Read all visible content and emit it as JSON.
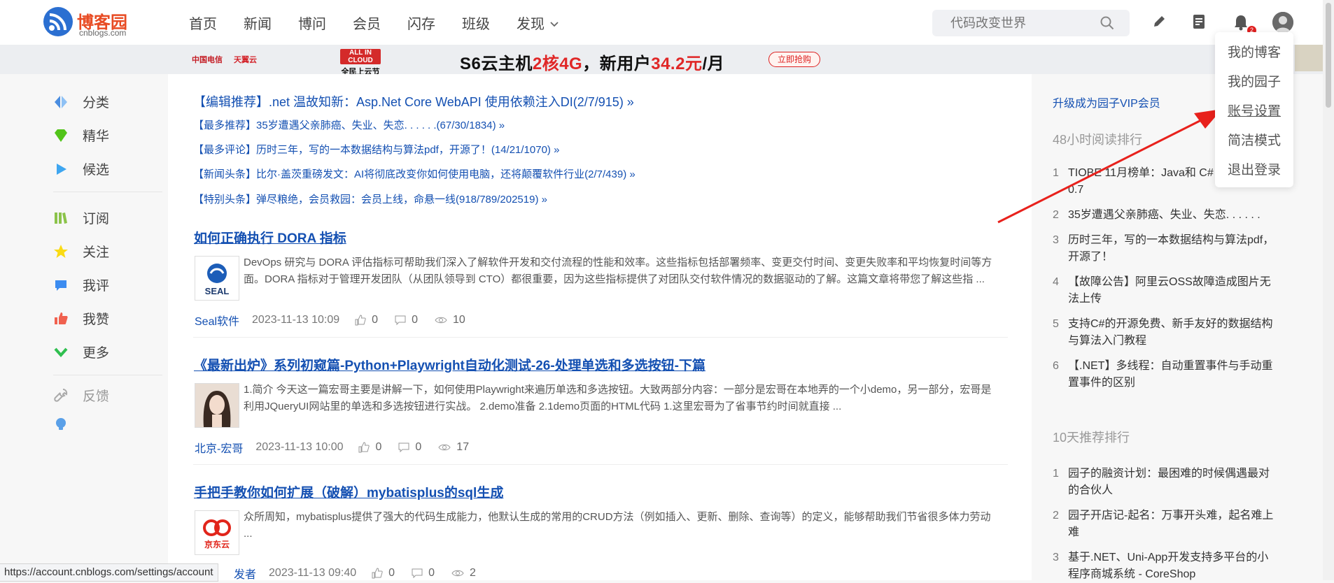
{
  "brand": {
    "name": "博客园",
    "domain": "cnblogs.com"
  },
  "nav": {
    "items": [
      "首页",
      "新闻",
      "博问",
      "会员",
      "闪存",
      "班级",
      "发现"
    ],
    "search_placeholder": "代码改变世界",
    "notification_count": "2"
  },
  "banner": {
    "brand1": "中国电信",
    "brand2": "天翼云",
    "tag_top": "ALL IN CLOUD",
    "tag_bottom": "全民上云节",
    "main_a": "S6云主机",
    "main_b": "2核4G",
    "main_c": "，新用户",
    "main_d": "34.2元",
    "main_e": "/月",
    "cta": "立即抢购"
  },
  "left": {
    "items": [
      "分类",
      "精华",
      "候选",
      "订阅",
      "关注",
      "我评",
      "我赞",
      "更多",
      "反馈"
    ]
  },
  "recommend": [
    "【编辑推荐】.net 温故知新：Asp.Net Core WebAPI 使用依赖注入DI(2/7/915) »",
    "【最多推荐】35岁遭遇父亲肺癌、失业、失恋. . . . . .(67/30/1834) »",
    "【最多评论】历时三年，写的一本数据结构与算法pdf，开源了！(14/21/1070) »",
    "【新闻头条】比尔·盖茨重磅发文：AI将彻底改变你如何使用电脑，还将颠覆软件行业(2/7/439) »",
    "【特别头条】弹尽粮绝，会员救园：会员上线，命悬一线(918/789/202519) »"
  ],
  "posts": [
    {
      "title": "如何正确执行 DORA 指标",
      "summary": "DevOps 研究与 DORA 评估指标可帮助我们深入了解软件开发和交付流程的性能和效率。这些指标包括部署频率、变更交付时间、变更失败率和平均恢复时间等方面。DORA 指标对于管理开发团队（从团队领导到 CTO）都很重要，因为这些指标提供了对团队交付软件情况的数据驱动的了解。这篇文章将带您了解这些指 ...",
      "author": "Seal软件",
      "date": "2023-11-13 10:09",
      "likes": "0",
      "comments": "0",
      "views": "10",
      "thumb_label": "SEAL"
    },
    {
      "title": "《最新出炉》系列初窥篇-Python+Playwright自动化测试-26-处理单选和多选按钮-下篇",
      "summary": "1.简介 今天这一篇宏哥主要是讲解一下，如何使用Playwright来遍历单选和多选按钮。大致两部分内容：一部分是宏哥在本地弄的一个小demo，另一部分，宏哥是利用JQueryUI网站里的单选和多选按钮进行实战。 2.demo准备 2.1demo页面的HTML代码 1.这里宏哥为了省事节约时间就直接 ...",
      "author": "北京-宏哥",
      "date": "2023-11-13 10:00",
      "likes": "0",
      "comments": "0",
      "views": "17",
      "thumb_label": ""
    },
    {
      "title": "手把手教你如何扩展（破解）mybatisplus的sql生成",
      "summary": "众所周知，mybatisplus提供了强大的代码生成能力，他默认生成的常用的CRUD方法（例如插入、更新、删除、查询等）的定义，能够帮助我们节省很多体力劳动 ...",
      "author": "发者",
      "date": "2023-11-13 09:40",
      "likes": "0",
      "comments": "0",
      "views": "2",
      "thumb_label": "京东云"
    }
  ],
  "right": {
    "vip": "升级成为园子VIP会员",
    "rank48_title": "48小时阅读排行",
    "rank48": [
      "TIOBE 11月榜单：Java和 C# 距缩小到0.7",
      "35岁遭遇父亲肺癌、失业、失恋. . . . . .",
      "历时三年，写的一本数据结构与算法pdf，开源了！",
      "【故障公告】阿里云OSS故障造成图片无法上传",
      "支持C#的开源免费、新手友好的数据结构与算法入门教程",
      "【.NET】多线程：自动重置事件与手动重置事件的区别"
    ],
    "rank10_title": "10天推荐排行",
    "rank10": [
      "园子的融资计划：最困难的时候偶遇最对的合伙人",
      "园子开店记-起名：万事开头难，起名难上难",
      "基于.NET、Uni-App开发支持多平台的小程序商城系统 - CoreShop"
    ]
  },
  "dropdown": [
    "我的博客",
    "我的园子",
    "账号设置",
    "简洁模式",
    "退出登录"
  ],
  "status_url": "https://account.cnblogs.com/settings/account"
}
